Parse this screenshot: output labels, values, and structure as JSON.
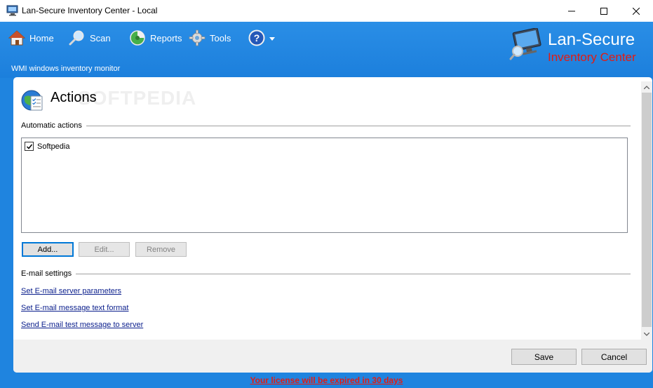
{
  "window": {
    "title": "Lan-Secure Inventory Center - Local",
    "minimize_icon": "minimize-icon",
    "maximize_icon": "maximize-icon",
    "close_icon": "close-icon"
  },
  "nav": {
    "items": [
      {
        "label": "Home",
        "icon": "home-icon"
      },
      {
        "label": "Scan",
        "icon": "magnifier-icon"
      },
      {
        "label": "Reports",
        "icon": "reports-icon"
      },
      {
        "label": "Tools",
        "icon": "gear-icon"
      },
      {
        "label": "",
        "icon": "help-icon"
      }
    ],
    "subtitle": "WMI windows inventory monitor"
  },
  "brand": {
    "line1": "Lan-Secure",
    "line2": "Inventory Center",
    "line2_color": "#e31b12"
  },
  "panel": {
    "title": "Actions",
    "watermark": "SOFTPEDIA",
    "automatic_actions_label": "Automatic actions",
    "actions_list": [
      {
        "label": "Softpedia",
        "checked": true
      }
    ],
    "buttons": {
      "add": "Add...",
      "edit": "Edit...",
      "remove": "Remove"
    },
    "email_settings_label": "E-mail settings",
    "links": [
      "Set E-mail server parameters",
      "Set E-mail message text format",
      "Send E-mail test message to server"
    ],
    "footer": {
      "save": "Save",
      "cancel": "Cancel"
    }
  },
  "license_notice": "Your license will be expired in 30 days",
  "colors": {
    "header_blue": "#1f84df",
    "accent_red": "#e31b12"
  }
}
